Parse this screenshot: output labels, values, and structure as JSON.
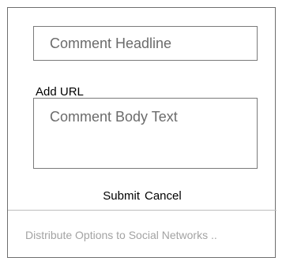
{
  "form": {
    "headline_placeholder": "Comment Headline",
    "add_url_label": "Add URL",
    "body_placeholder": "Comment Body Text",
    "submit_label": "Submit",
    "cancel_label": "Cancel",
    "distribute_label": "Distribute Options to Social Networks .."
  }
}
